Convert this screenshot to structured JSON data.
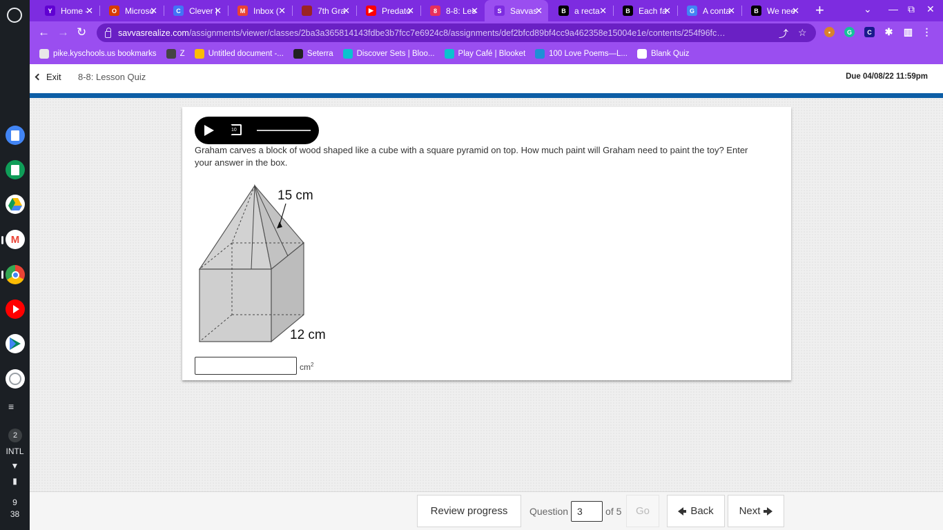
{
  "tabs": [
    {
      "title": "Home -",
      "favicon": "yahoo-icon",
      "color": "#6001d2",
      "glyph": "Y"
    },
    {
      "title": "Microso",
      "favicon": "office-icon",
      "color": "#d83b01",
      "glyph": "O"
    },
    {
      "title": "Clever |",
      "favicon": "clever-icon",
      "color": "#4274f6",
      "glyph": "C"
    },
    {
      "title": "Inbox (",
      "favicon": "gmail-icon",
      "color": "#ea4335",
      "glyph": "M"
    },
    {
      "title": "7th Gra",
      "favicon": "doc-icon",
      "color": "#9b2424",
      "glyph": ""
    },
    {
      "title": "Predato",
      "favicon": "youtube-icon",
      "color": "#ff0000",
      "glyph": "▶"
    },
    {
      "title": "8-8: Les",
      "favicon": "classroom-icon",
      "color": "#e8305b",
      "glyph": "8"
    },
    {
      "title": "Savvas",
      "favicon": "savvas-icon",
      "color": "#7d2ce0",
      "glyph": "S"
    },
    {
      "title": "a recta",
      "favicon": "brainly-icon",
      "color": "#000000",
      "glyph": "B"
    },
    {
      "title": "Each fa",
      "favicon": "brainly-icon",
      "color": "#000000",
      "glyph": "B"
    },
    {
      "title": "A conta",
      "favicon": "google-icon",
      "color": "#4285f4",
      "glyph": "G"
    },
    {
      "title": "We nee",
      "favicon": "brainly-icon",
      "color": "#000000",
      "glyph": "B"
    }
  ],
  "active_tab": 7,
  "address": {
    "host": "savvasrealize.com",
    "path": "/assignments/viewer/classes/2ba3a365814143fdbe3b7fcc7e6924c8/assignments/def2bfcd89bf4cc9a462358e15004e1e/contents/254f96fc-740b..."
  },
  "bookmarks": [
    {
      "label": "pike.kyschools.us bookmarks",
      "icon": "folder-icon",
      "color": "#e8e8e8"
    },
    {
      "label": "Z",
      "icon": "globe-icon",
      "color": "#444444"
    },
    {
      "label": "Untitled document -...",
      "icon": "drive-icon",
      "color": "#fbbc04"
    },
    {
      "label": "Seterra",
      "icon": "seterra-icon",
      "color": "#222222"
    },
    {
      "label": "Discover Sets | Bloo...",
      "icon": "blooket-icon",
      "color": "#0bc2cf"
    },
    {
      "label": "Play Café | Blooket",
      "icon": "blooket-icon",
      "color": "#0bc2cf"
    },
    {
      "label": "100 Love Poems—L...",
      "icon": "p-icon",
      "color": "#1f8fd6"
    },
    {
      "label": "Blank Quiz",
      "icon": "list-icon",
      "color": "#ffffff"
    }
  ],
  "header": {
    "exit_label": "Exit",
    "quiz_title": "8-8: Lesson Quiz",
    "due": "Due 04/08/22 11:59pm"
  },
  "question": {
    "text": "Graham carves a block of wood shaped like a cube with a square pyramid on top. How much paint will Graham need to paint the toy? Enter your answer in the box.",
    "figure_labels": {
      "slant": "15 cm",
      "edge": "12 cm"
    },
    "answer_value": "",
    "unit": "cm",
    "unit_exp": "2"
  },
  "footer": {
    "review_label": "Review progress",
    "question_label": "Question",
    "current": "3",
    "of_label": "of 5",
    "go_label": "Go",
    "back_label": "Back",
    "next_label": "Next"
  },
  "shelf": {
    "notif_count": "2",
    "ime": "INTL",
    "time_hour": "9",
    "time_min": "38"
  }
}
